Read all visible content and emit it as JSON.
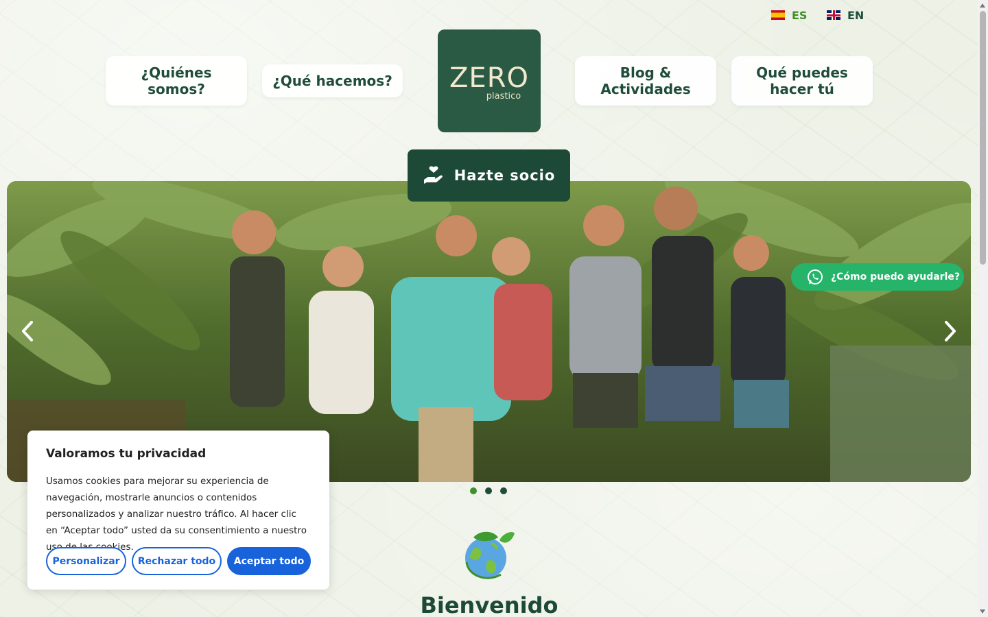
{
  "languages": [
    {
      "code": "ES",
      "flag": "spain-flag-icon",
      "active": true
    },
    {
      "code": "EN",
      "flag": "uk-flag-icon",
      "active": false
    }
  ],
  "nav": {
    "quienes": "¿Quiénes somos?",
    "que": "¿Qué hacemos?",
    "blog": "Blog & Actividades",
    "puedes": "Qué puedes hacer tú"
  },
  "logo": {
    "main": "ZERO",
    "sub": "plastico"
  },
  "join_button": "Hazte socio",
  "whatsapp": "¿Cómo puedo ayudarle?",
  "carousel": {
    "slides": 3,
    "active_index": 0
  },
  "welcome_heading": "Bienvenido",
  "cookie_banner": {
    "title": "Valoramos tu privacidad",
    "text": "Usamos cookies para mejorar su experiencia de navegación, mostrarle anuncios o contenidos personalizados y analizar nuestro tráfico. Al hacer clic en “Aceptar todo” usted da su consentimiento a nuestro uso de las cookies.",
    "customize": "Personalizar",
    "reject": "Rechazar todo",
    "accept": "Aceptar todo"
  },
  "colors": {
    "brand_dark": "#1d4a37",
    "logo_bg": "#2a5944",
    "accent_green": "#3f8f2b",
    "whatsapp": "#25b46a",
    "cookie_blue": "#1863dc"
  }
}
